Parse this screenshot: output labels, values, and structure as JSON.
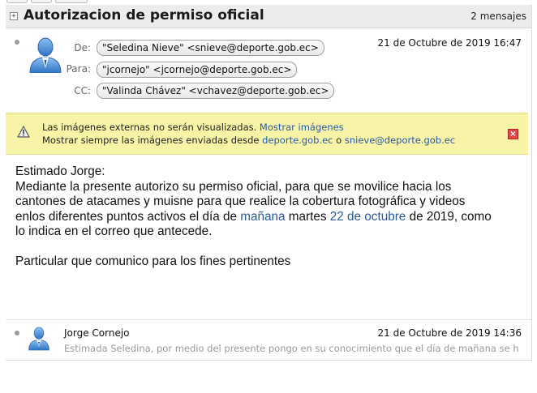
{
  "thread": {
    "title": "Autorizacion de permiso oficial",
    "count": "2 mensajes"
  },
  "message1": {
    "from_label": "De:",
    "from": "\"Seledina Nieve\" <snieve@deporte.gob.ec>",
    "to_label": "Para:",
    "to": "\"jcornejo\" <jcornejo@deporte.gob.ec>",
    "cc_label": "CC:",
    "cc": "\"Valinda Chávez\" <vchavez@deporte.gob.ec>",
    "date": "21 de Octubre de 2019 16:47",
    "warning": {
      "text1": "Las imágenes externas no serán visualizadas.",
      "link1": "Mostrar imágenes",
      "text2": "Mostrar siempre las imágenes enviadas desde",
      "link2": "deporte.gob.ec",
      "or": "o",
      "link3": "snieve@deporte.gob.ec"
    },
    "body": {
      "greeting": "Estimado Jorge:",
      "line1": "Mediante la presente autorizo su permiso oficial, para que se movilice hacia los",
      "line2": "cantones de atacames y muisne para que realice la cobertura fotográfica y videos",
      "line3_a": "enlos diferentes puntos activos el día de ",
      "line3_link1": "mañana",
      "line3_b": " martes ",
      "line3_link2": "22 de octubre",
      "line3_c": " de 2019, como",
      "line4": "lo indica en el correo que antecede.",
      "closing": "Particular que comunico para los fines pertinentes"
    }
  },
  "message2": {
    "sender": "Jorge Cornejo",
    "date": "21 de Octubre de 2019 14:36",
    "snippet": "Estimada Seledina, por medio del presente pongo en su conocimiento que el día de mañana se h"
  },
  "colors": {
    "warning_bg": "#f7f4a8",
    "link": "#2a5aa8",
    "avatar": "#4a8ed6"
  }
}
